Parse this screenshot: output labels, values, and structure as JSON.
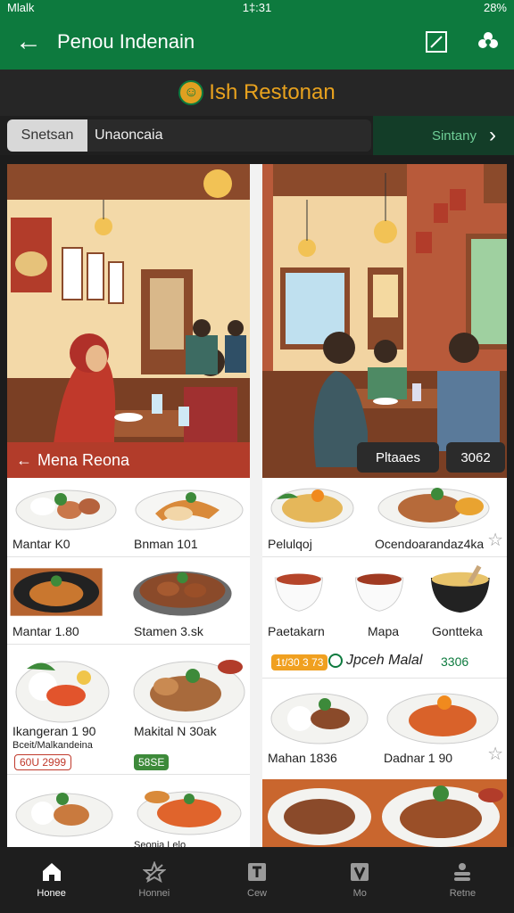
{
  "status": {
    "carrier": "Mlalk",
    "time": "1‡:31",
    "battery": "28%"
  },
  "appbar": {
    "title": "Penou Indenain"
  },
  "brand": {
    "name": "Ish Restonan"
  },
  "filter": {
    "chip": "Snetsan",
    "value": "Unaoncaia",
    "right": "Sintany"
  },
  "hero": {
    "left_label": "Mena Reona",
    "right_label_1": "Pltaaes",
    "right_label_2": "3062"
  },
  "menu": {
    "left": [
      {
        "label": "Mantar K0"
      },
      {
        "label": "Bnman 101"
      },
      {
        "label": "Mantar 1.80"
      },
      {
        "label": "Stamen 3.sk"
      },
      {
        "label": "Ikangeran 1 90",
        "sub": "Bceit/Malkandeina",
        "tag": "60U 2999"
      },
      {
        "label": "Makital N 30ak",
        "tag": "58SE"
      },
      {
        "label": ""
      },
      {
        "label": "Seonia Lelo"
      }
    ],
    "right": [
      {
        "label": "Pelulqoj"
      },
      {
        "label": "Ocendoarandaz4ka"
      },
      {
        "label": "Paetakarn"
      },
      {
        "label": "Mapa"
      },
      {
        "label": "Gontteka"
      },
      {
        "tag": "1t/30 3 73",
        "promo": "Jpceh Malal",
        "price": "3306"
      },
      {
        "label": "Mahan 1836"
      },
      {
        "label": "Dadnar 1 90"
      }
    ]
  },
  "tabs": [
    {
      "label": "Honee",
      "icon": "home-icon"
    },
    {
      "label": "Honnei",
      "icon": "star-crossed-icon"
    },
    {
      "label": "Cew",
      "icon": "t-box-icon"
    },
    {
      "label": "Mo",
      "icon": "v-box-icon"
    },
    {
      "label": "Retne",
      "icon": "person-stack-icon"
    }
  ],
  "colors": {
    "primary": "#0d7a3e",
    "accent": "#e8a21e",
    "banner": "#b23c2a"
  }
}
